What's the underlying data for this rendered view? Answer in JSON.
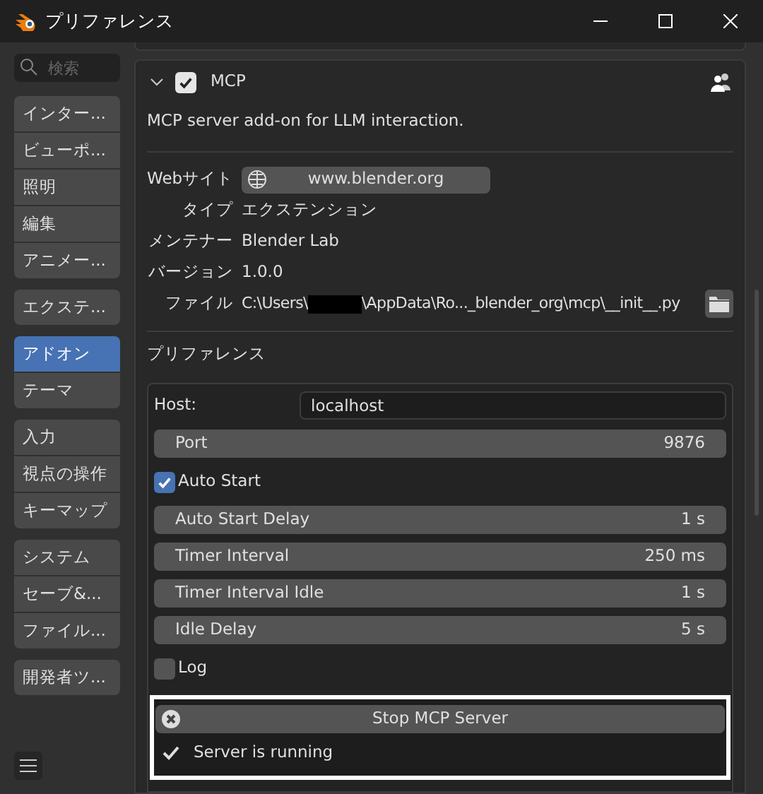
{
  "window": {
    "title": "プリファレンス"
  },
  "sidebar": {
    "search": {
      "placeholder": "検索"
    },
    "groups": [
      {
        "items": [
          {
            "label": "インター...",
            "selected": false
          },
          {
            "label": "ビューポ...",
            "selected": false
          },
          {
            "label": "照明",
            "selected": false
          },
          {
            "label": "編集",
            "selected": false
          },
          {
            "label": "アニメー...",
            "selected": false
          }
        ]
      },
      {
        "items": [
          {
            "label": "エクステ...",
            "selected": false
          }
        ]
      },
      {
        "items": [
          {
            "label": "アドオン",
            "selected": true
          },
          {
            "label": "テーマ",
            "selected": false
          }
        ]
      },
      {
        "items": [
          {
            "label": "入力",
            "selected": false
          },
          {
            "label": "視点の操作",
            "selected": false
          },
          {
            "label": "キーマップ",
            "selected": false
          }
        ]
      },
      {
        "items": [
          {
            "label": "システム",
            "selected": false
          },
          {
            "label": "セーブ&...",
            "selected": false
          },
          {
            "label": "ファイル...",
            "selected": false
          }
        ]
      },
      {
        "items": [
          {
            "label": "開発者ツ...",
            "selected": false
          }
        ]
      }
    ]
  },
  "addon": {
    "name": "MCP",
    "expanded": true,
    "enabled": true,
    "description": "MCP server add-on for LLM interaction.",
    "info": [
      {
        "kind": "link",
        "label": "Webサイト",
        "value": "www.blender.org"
      },
      {
        "kind": "text",
        "label": "タイプ",
        "value": "エクステンション"
      },
      {
        "kind": "text",
        "label": "メンテナー",
        "value": "Blender Lab"
      },
      {
        "kind": "text",
        "label": "バージョン",
        "value": "1.0.0"
      },
      {
        "kind": "file",
        "label": "ファイル",
        "value_start": "C:\\Users\\",
        "value_end": "\\AppData\\Ro..._blender_org\\mcp\\__init__.py"
      }
    ],
    "preferences_title": "プリファレンス",
    "settings": [
      {
        "kind": "field",
        "label": "Host:",
        "value": "localhost"
      },
      {
        "kind": "number",
        "label": "Port",
        "value": "9876"
      },
      {
        "kind": "checkbox",
        "label": "Auto Start",
        "checked": true
      },
      {
        "kind": "number",
        "label": "Auto Start Delay",
        "value": "1 s"
      },
      {
        "kind": "number",
        "label": "Timer Interval",
        "value": "250 ms"
      },
      {
        "kind": "number",
        "label": "Timer Interval Idle",
        "value": "1 s"
      },
      {
        "kind": "number",
        "label": "Idle Delay",
        "value": "5 s"
      },
      {
        "kind": "checkbox",
        "label": "Log",
        "checked": false
      }
    ],
    "server": {
      "button": "Stop MCP Server",
      "status": "Server is running"
    }
  }
}
